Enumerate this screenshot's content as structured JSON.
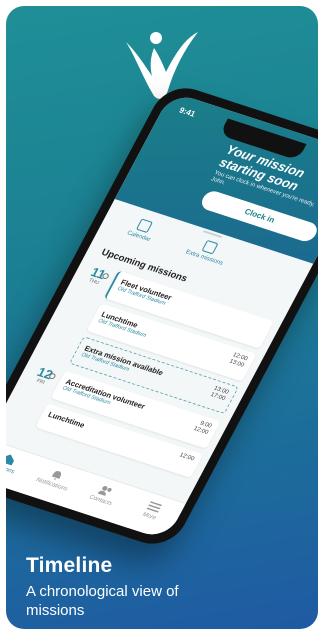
{
  "phone": {
    "status_time": "9:41",
    "hero": {
      "title": "Your mission starting soon",
      "subtitle": "You can clock in whenever you're ready, John.",
      "clock_in_label": "Clock in"
    },
    "quick_actions": [
      {
        "label": "Calendar",
        "icon": "calendar-icon"
      },
      {
        "label": "Extra missions",
        "icon": "extra-missions-icon"
      }
    ],
    "section_title": "Upcoming missions",
    "days": [
      {
        "num": "11",
        "name": "THU"
      },
      {
        "num": "12",
        "name": "FRI"
      }
    ],
    "missions": [
      {
        "title": "Fleet volunteer",
        "location": "Old Trafford Stadium",
        "start": "",
        "end": ""
      },
      {
        "title": "Lunchtime",
        "location": "Old Trafford Stadium",
        "start": "12:00",
        "end": "13:00"
      },
      {
        "title": "Extra mission available",
        "location": "Old Trafford Stadium",
        "start": "13:00",
        "end": "17:00"
      },
      {
        "title": "Accreditation volunteer",
        "location": "Old Trafford Stadium",
        "start": "9:00",
        "end": "12:00"
      },
      {
        "title": "Lunchtime",
        "location": "",
        "start": "12:00",
        "end": ""
      }
    ],
    "tabs": [
      {
        "label": "Missions",
        "icon": "home-icon",
        "active": true
      },
      {
        "label": "Notifications",
        "icon": "bell-icon",
        "active": false
      },
      {
        "label": "Contacts",
        "icon": "contacts-icon",
        "active": false
      },
      {
        "label": "More",
        "icon": "menu-icon",
        "active": false
      }
    ]
  },
  "footer": {
    "title": "Timeline",
    "subtitle": "A chronological view of missions"
  },
  "colors": {
    "accent": "#2b8aa0",
    "background_start": "#1f8f96",
    "background_end": "#1f5aa3"
  }
}
